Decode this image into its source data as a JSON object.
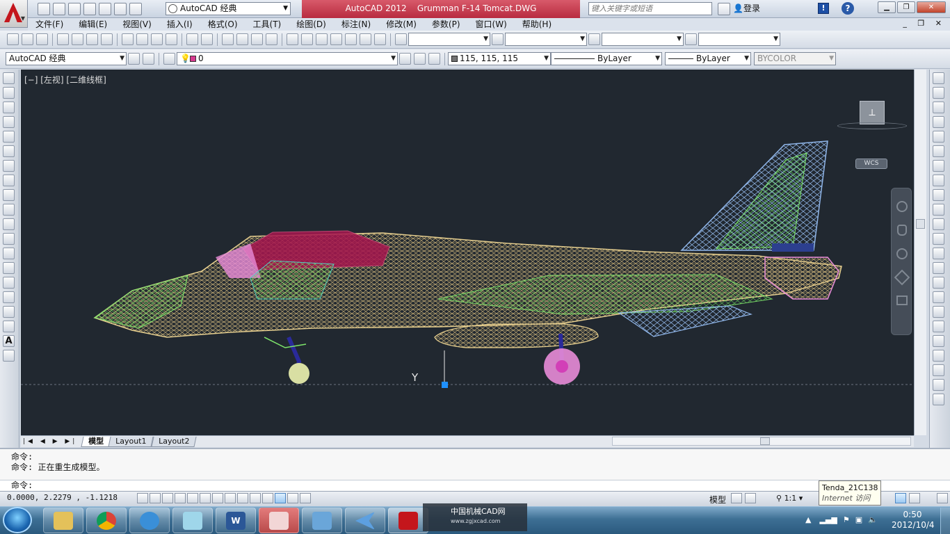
{
  "title_bar": {
    "workspace": "AutoCAD 经典",
    "title": "AutoCAD 2012    Grumman F-14 Tomcat.DWG",
    "search_placeholder": "键入关键字或短语",
    "login": "登录"
  },
  "menu": [
    "文件(F)",
    "编辑(E)",
    "视图(V)",
    "插入(I)",
    "格式(O)",
    "工具(T)",
    "绘图(D)",
    "标注(N)",
    "修改(M)",
    "参数(P)",
    "窗口(W)",
    "帮助(H)"
  ],
  "toolbar2": {
    "workspace_combo": "AutoCAD 经典",
    "layer_combo": "0",
    "color_combo": "115, 115, 115",
    "linetype_combo": "ByLayer",
    "lineweight_combo": "ByLayer",
    "plotstyle_combo": "BYCOLOR"
  },
  "viewport": {
    "label": "[−] [左视] [二维线框]",
    "wcs": "WCS",
    "ucs_y": "Y"
  },
  "tabs": {
    "nav": "|◀ ◀ ▶ ▶|",
    "items": [
      "模型",
      "Layout1",
      "Layout2"
    ]
  },
  "command": {
    "lines": [
      "命令:",
      "命令:  正在重生成模型。"
    ],
    "prompt": "命令:"
  },
  "status": {
    "coords": "0.0000,  2.2279 ,  -1.1218",
    "model": "模型",
    "scale": "1:1"
  },
  "tooltip": {
    "name": "Tenda_21C138",
    "status": "Internet 访问"
  },
  "watermark": {
    "name": "中国机械CAD网",
    "url": "www.zgjxcad.com"
  },
  "clock": {
    "time": "0:50",
    "date": "2012/10/4"
  },
  "colors": {
    "drawing_bg": "#212830",
    "fuselage": "#e6cf8f",
    "canopy": "#a8174f",
    "wireframe_green": "#7ee66b",
    "wireframe_blue": "#8fb5e8",
    "wing_magenta": "#e88bd8"
  }
}
